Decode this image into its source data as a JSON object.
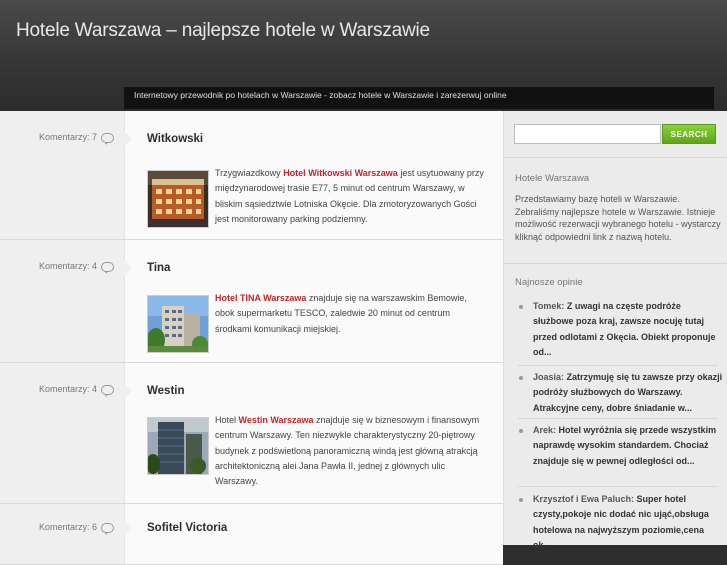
{
  "header": {
    "site_title": "Hotele Warszawa – najlepsze hotele w Warszawie",
    "tagline": "Internetowy przewodnik po hotelach w Warszawie - zobacz hotele w Warszawie i zarezerwuj online"
  },
  "posts": [
    {
      "comments": "Komentarzy: 7",
      "title": "Witkowski",
      "text_before": "Trzygwiazdkowy ",
      "link": "Hotel Witkowski Warszawa",
      "text_after": " jest usytuowany przy międzynarodowej trasie E77, 5 minut od centrum Warszawy, w bliskim sąsiedztwie Lotniska Okęcie. Dla zmotoryzowanych Gości jest monitorowany parking podziemny."
    },
    {
      "comments": "Komentarzy: 4",
      "title": "Tina",
      "text_before": "",
      "link": "Hotel TINA Warszawa",
      "text_after": " znajduje się na warszawskim Bemowie, obok supermarketu TESCO, zaledwie 20 minut od centrum środkami komunikacji miejskiej."
    },
    {
      "comments": "Komentarzy: 4",
      "title": "Westin",
      "text_before": "Hotel ",
      "link": "Westin Warszawa",
      "text_after": " znajduje się w biznesowym i finansowym centrum Warszawy. Ten niezwykle charakterystyczny 20-piętrowy budynek z podświetloną panoramiczną windą jest główną atrakcją architektoniczną alei Jana Pawła II, jednej z głównych ulic Warszawy."
    },
    {
      "comments": "Komentarzy: 6",
      "title": "Sofitel Victoria"
    }
  ],
  "sidebar": {
    "search_button": "SEARCH",
    "about_title": "Hotele Warszawa",
    "about_text": "Przedstawiamy bazę hoteli w Warszawie. Zebraliśmy najlepsze hotele w Warszawie. Istnieje możliwość rezerwacji wybranego hotelu - wystarczy kliknąć odpowiedni link z nazwą hotelu.",
    "opinions_title": "Najnosze opinie",
    "opinions": [
      {
        "author": "Tomek:",
        "text": " Z uwagi na częste podróże służbowe poza kraj, zawsze nocuję tutaj przed odlotami z Okęcia. Obiekt proponuje od..."
      },
      {
        "author": "Joasia:",
        "text": " Zatrzymuję się tu zawsze przy okazji podróży służbowych do Warszawy. Atrakcyjne ceny, dobre śniadanie w..."
      },
      {
        "author": "Arek:",
        "text": " Hotel wyróżnia się przede wszystkim naprawdę wysokim standardem. Chociaż znajduje się w pewnej odległości od..."
      },
      {
        "author": "Krzysztof i Ewa Paluch:",
        "text": " Super hotel czysty,pokoje nic dodać nic ująć,obsługa hotelowa na najwyższym poziomie,cena ok..."
      }
    ]
  },
  "colors": {
    "link_red": "#c0262a",
    "search_green": "#6db524",
    "header_dark": "#353535"
  }
}
